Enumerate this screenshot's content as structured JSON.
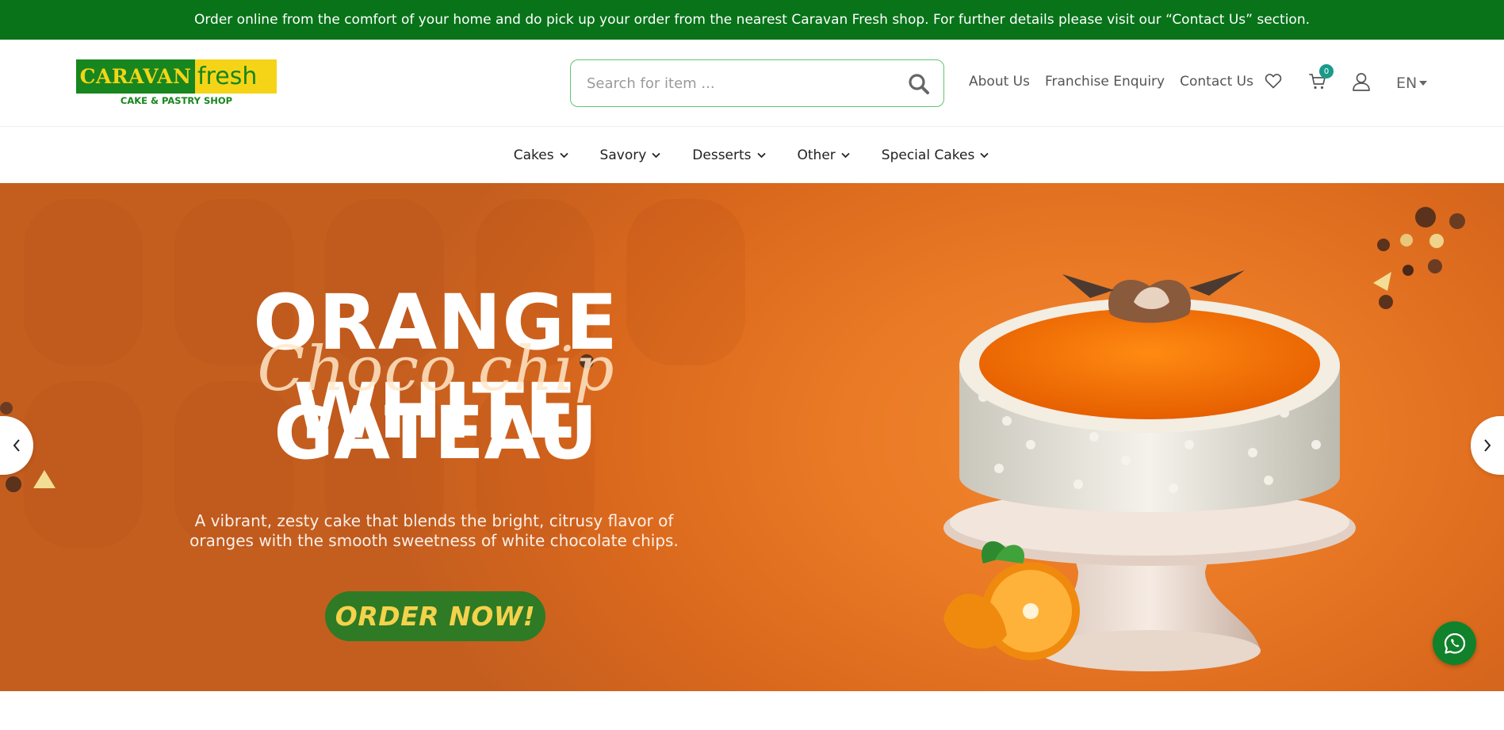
{
  "announcement": "Order online from the comfort of your home and do pick up your order from the nearest Caravan Fresh shop. For further details please visit our “Contact Us” section.",
  "logo": {
    "word1": "CARAVAN",
    "word2": "fresh",
    "tagline": "CAKE & PASTRY SHOP"
  },
  "search": {
    "placeholder": "Search for item ..."
  },
  "header_links": [
    "About Us",
    "Franchise Enquiry",
    "Contact Us"
  ],
  "cart_count": "0",
  "language": "EN",
  "menu": [
    "Cakes",
    "Savory",
    "Desserts",
    "Other",
    "Special Cakes"
  ],
  "hero": {
    "title_line1": "ORANGE WHITE",
    "title_script": "Choco chip",
    "title_line2": "GATEAU",
    "description": "A vibrant, zesty cake that blends the bright, citrusy flavor of oranges with the smooth sweetness of white chocolate chips.",
    "cta": "ORDER NOW!"
  },
  "colors": {
    "topbar": "#087319",
    "brand_green": "#17861e",
    "brand_yellow": "#f5d417",
    "hero_orange": "#ea7a25",
    "cta_green": "#2f7a25",
    "cta_text": "#f5d24b",
    "badge": "#1b9a8a"
  },
  "icons": [
    "search-icon",
    "heart-icon",
    "cart-icon",
    "user-icon",
    "chevron-down-icon",
    "chevron-left-icon",
    "chevron-right-icon",
    "whatsapp-icon"
  ]
}
